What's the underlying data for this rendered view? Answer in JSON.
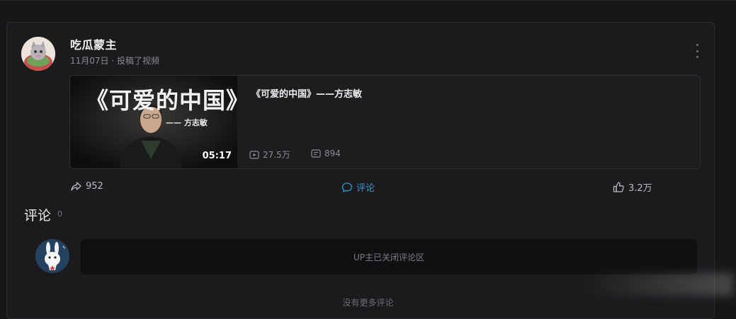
{
  "post": {
    "author_name": "吃瓜蒙主",
    "meta": "11月07日 · 投稿了视频"
  },
  "video": {
    "thumbnail_title": "《可爱的中国》",
    "thumbnail_subtitle": "—— 方志敏",
    "duration": "05:17",
    "title": "《可爱的中国》——方志敏",
    "views": "27.5万",
    "danmaku": "894"
  },
  "actions": {
    "share_count": "952",
    "comment_label": "评论",
    "like_count": "3.2万"
  },
  "comments": {
    "heading": "评论",
    "count": "0",
    "closed_notice": "UP主已关闭评论区",
    "no_more": "没有更多评论"
  },
  "colors": {
    "background": "#171719",
    "card": "#1b1b1e",
    "accent": "#2a9bd4"
  },
  "icons": [
    "more-vertical-icon",
    "play-count-icon",
    "danmaku-icon",
    "share-icon",
    "comment-icon",
    "like-icon"
  ]
}
